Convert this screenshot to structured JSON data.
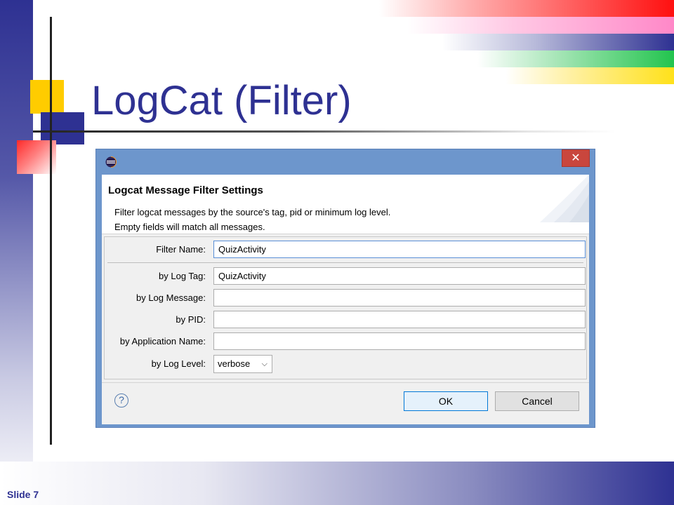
{
  "slide": {
    "title": "LogCat (Filter)",
    "number_label": "Slide 7"
  },
  "dialog": {
    "close_glyph": "✕",
    "header_title": "Logcat Message Filter Settings",
    "description_line1": "Filter logcat messages by the source's tag, pid or minimum log level.",
    "description_line2": "Empty fields will match all messages.",
    "fields": {
      "filter_name": {
        "label": "Filter Name:",
        "value": "QuizActivity"
      },
      "log_tag": {
        "label": "by Log Tag:",
        "value": "QuizActivity"
      },
      "log_message": {
        "label": "by Log Message:",
        "value": ""
      },
      "pid": {
        "label": "by PID:",
        "value": ""
      },
      "app_name": {
        "label": "by Application Name:",
        "value": ""
      },
      "log_level": {
        "label": "by Log Level:",
        "value": "verbose"
      }
    },
    "help_glyph": "?",
    "ok_label": "OK",
    "cancel_label": "Cancel"
  },
  "colors": {
    "slide_blue": "#2e3192",
    "dialog_frame": "#6d96cc",
    "close_red": "#c9463d"
  },
  "icons": [
    "app-icon",
    "close-icon",
    "chevron-down-icon",
    "help-icon"
  ]
}
